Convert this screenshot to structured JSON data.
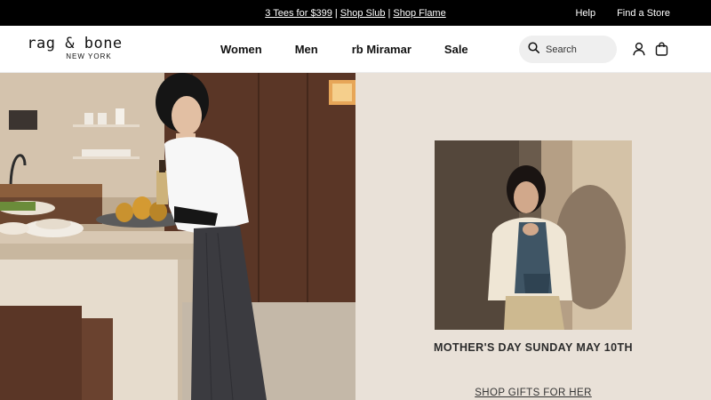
{
  "announcement": {
    "promos": [
      "3 Tees for $399",
      "Shop Slub",
      "Shop Flame"
    ],
    "separator": "|",
    "help": "Help",
    "find_store": "Find a Store"
  },
  "header": {
    "logo_text": "rag & bone",
    "logo_subtext": "NEW YORK",
    "nav": [
      "Women",
      "Men",
      "rb Miramar",
      "Sale"
    ],
    "search_placeholder": "Search",
    "icons": [
      "search-icon",
      "account-icon",
      "bag-icon"
    ]
  },
  "hero": {
    "left_image": "woman in white shirt in kitchen with pears",
    "right": {
      "image": "woman in fleece jacket against wall",
      "title": "MOTHER'S DAY SUNDAY MAY 10TH",
      "cta": "SHOP GIFTS FOR HER"
    }
  },
  "colors": {
    "announcement_bg": "#000000",
    "right_panel_bg": "#e9e1d8",
    "search_bg": "#efefef"
  }
}
